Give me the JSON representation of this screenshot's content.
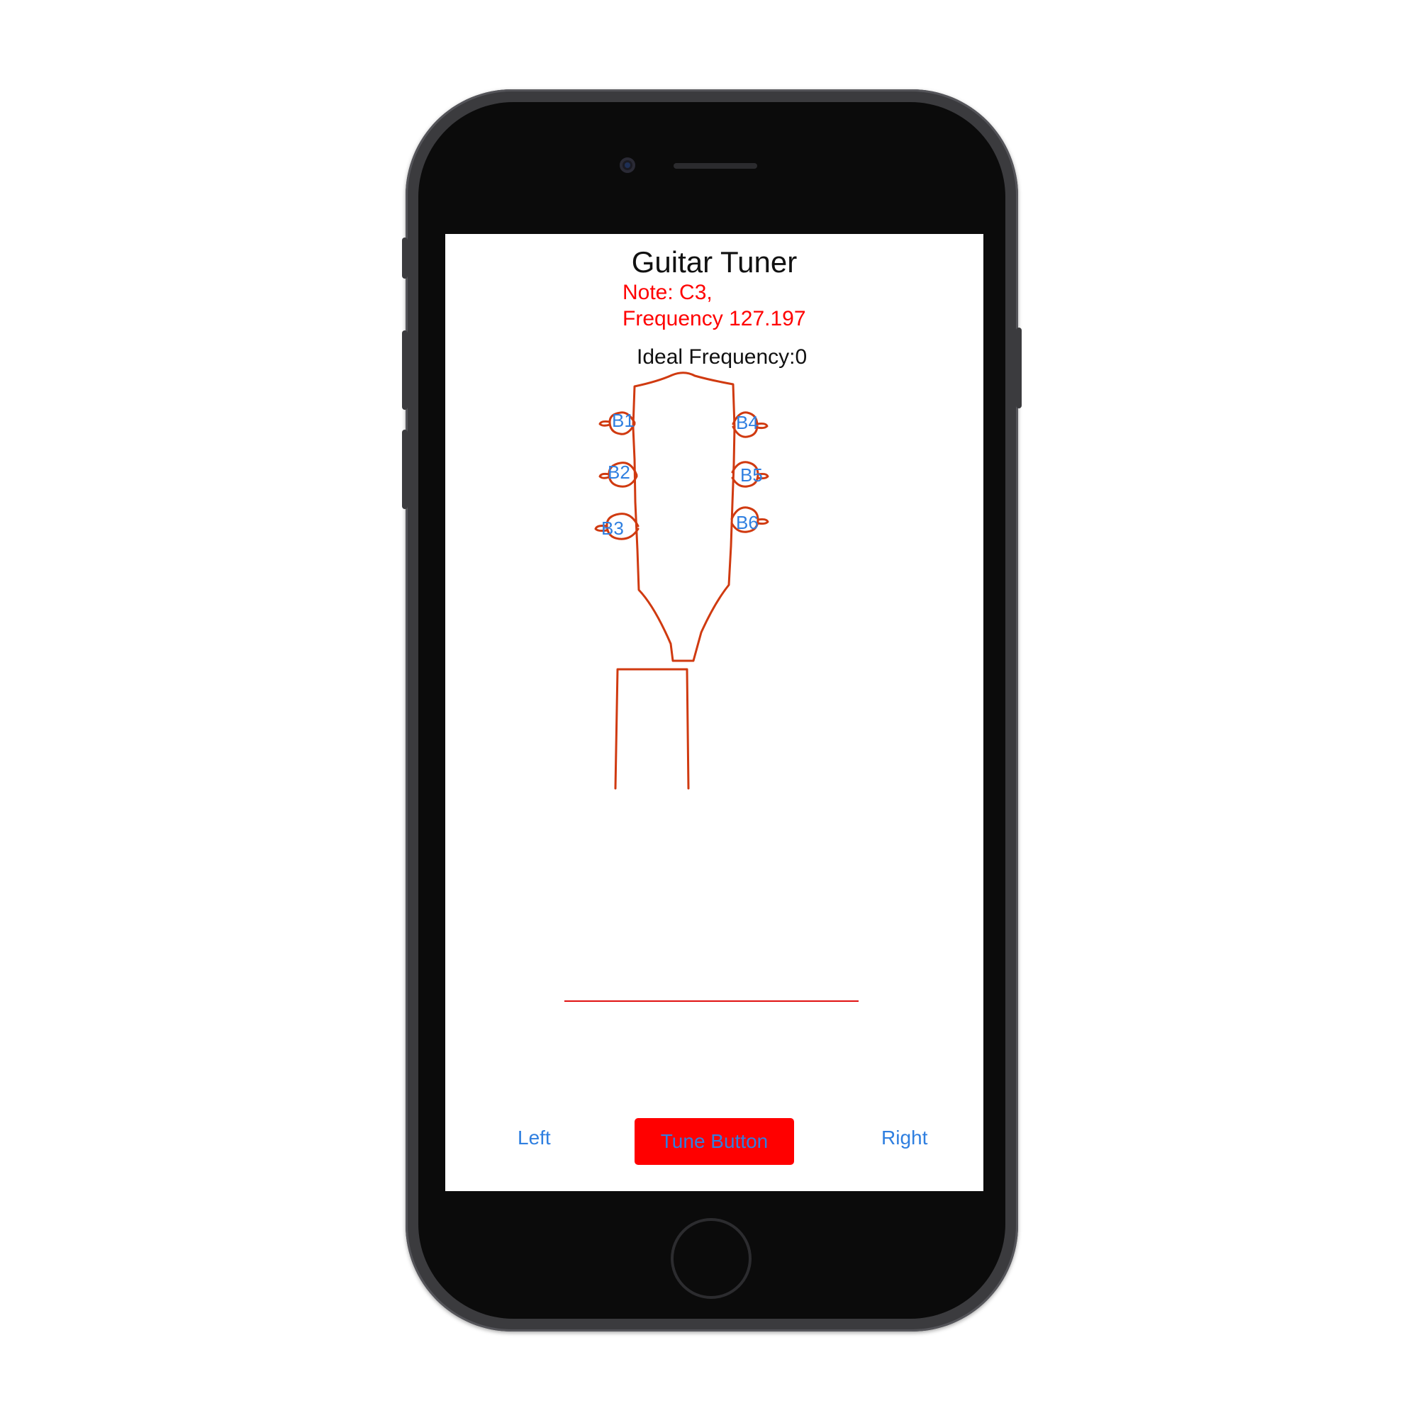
{
  "app": {
    "title": "Guitar Tuner",
    "note": "Note: C3,",
    "frequency": "Frequency 127.197",
    "ideal_frequency": "Ideal Frequency:0"
  },
  "pegs": {
    "b1": "B1",
    "b2": "B2",
    "b3": "B3",
    "b4": "B4",
    "b5": "B5",
    "b6": "B6"
  },
  "controls": {
    "left_label": "Left",
    "tune_label": "Tune Button",
    "right_label": "Right"
  },
  "colors": {
    "accent_red": "#ff0000",
    "link_blue": "#2f7fe0",
    "headstock_stroke": "#d03a10"
  }
}
